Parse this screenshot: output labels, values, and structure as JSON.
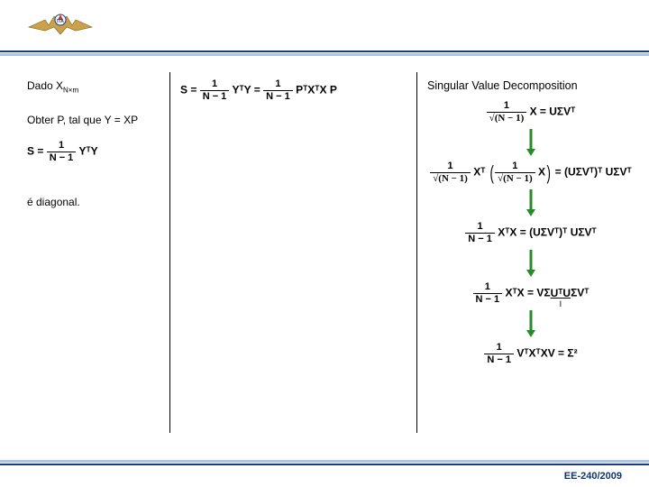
{
  "header": {
    "logo_name": "ita-wings-logo"
  },
  "left": {
    "given_prefix": "Dado X",
    "given_sub": "N×m",
    "obter": "Obter P, tal que Y = XP",
    "s_eq": {
      "lhs": "S =",
      "num": "1",
      "den": "N − 1",
      "rhs": "YᵀY"
    },
    "diag": "é diagonal."
  },
  "mid": {
    "eq": {
      "lhs": "S =",
      "num1": "1",
      "den1": "N − 1",
      "mid1": "YᵀY =",
      "num2": "1",
      "den2": "N − 1",
      "rhs": "PᵀXᵀX P"
    }
  },
  "right": {
    "title": "Singular Value Decomposition",
    "eq1": {
      "num": "1",
      "den": "√(N − 1)",
      "lhs_after": "X = UΣVᵀ"
    },
    "eq2": {
      "numL": "1",
      "denL": "√(N − 1)",
      "midL": "Xᵀ",
      "numR": "1",
      "denR": "√(N − 1)",
      "midR": "X",
      "eq": "=",
      "uL": "(UΣVᵀ)ᵀ",
      "uR": "UΣVᵀ"
    },
    "eq3": {
      "num": "1",
      "den": "N − 1",
      "lhs": "XᵀX =",
      "p1": "(UΣVᵀ)ᵀ",
      "p2": "UΣVᵀ"
    },
    "eq4": {
      "num": "1",
      "den": "N − 1",
      "lhs": "XᵀX =",
      "rhs_a": "VΣ",
      "rhs_b": "UᵀU",
      "rhs_c": "ΣVᵀ",
      "under": "I"
    },
    "eq5": {
      "num": "1",
      "den": "N − 1",
      "lhs": "VᵀXᵀXV =",
      "rhs": "Σ²"
    }
  },
  "footer": {
    "text": "EE-240/2009"
  },
  "colors": {
    "rule_dark": "#1b3a7a",
    "rule_light": "#a9c6ea"
  }
}
